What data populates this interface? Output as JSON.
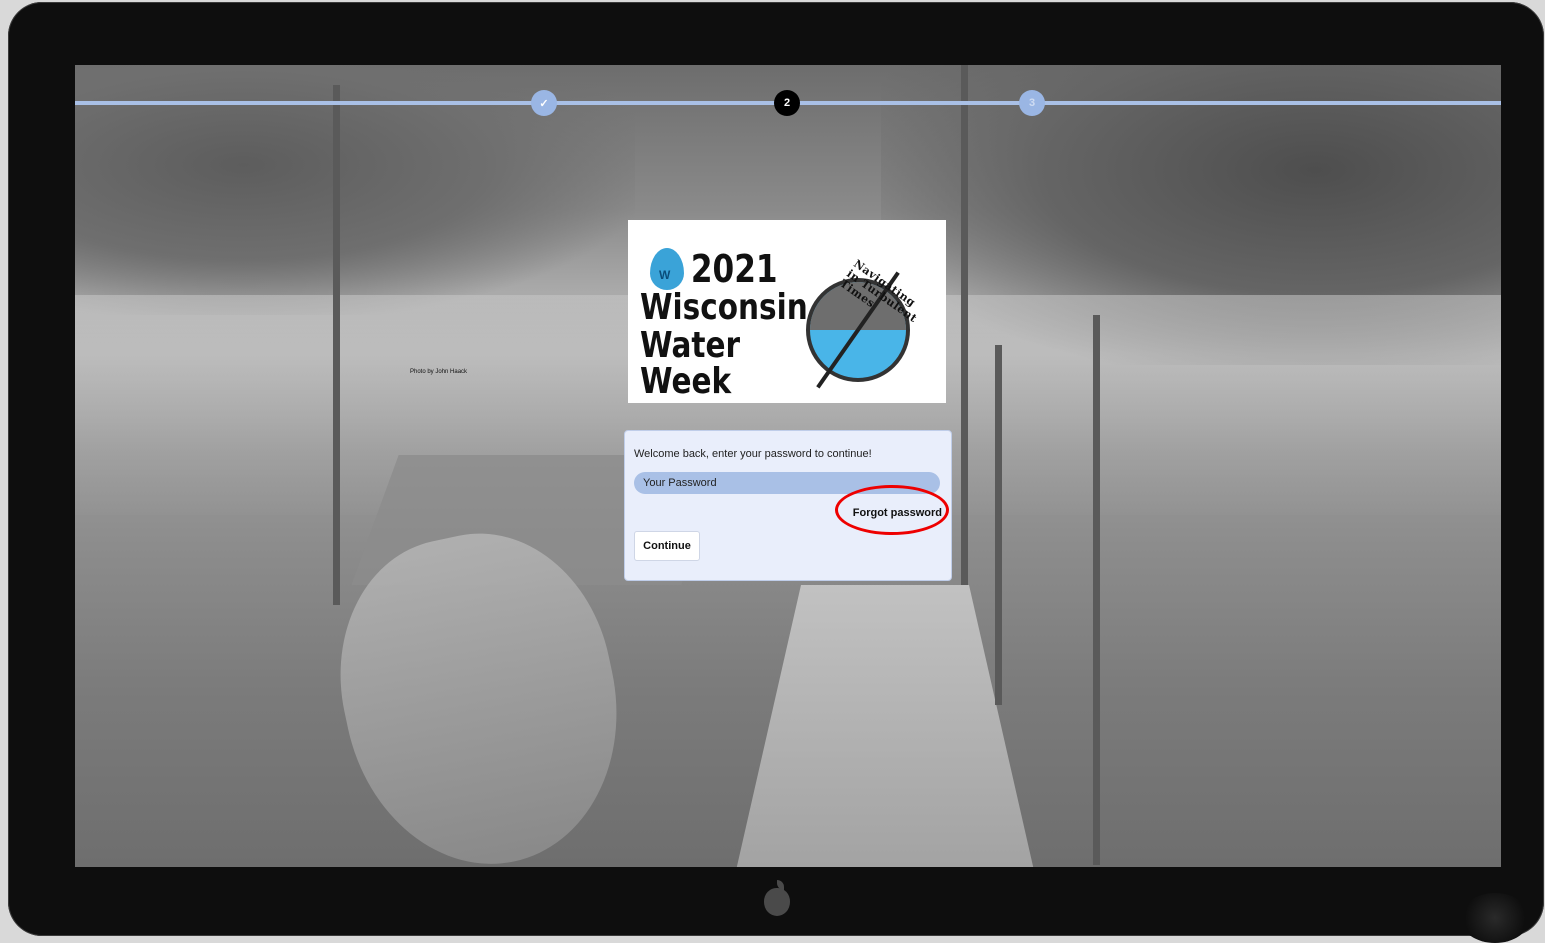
{
  "progress": {
    "steps": [
      {
        "label": "",
        "state": "done",
        "icon": "check-icon"
      },
      {
        "label": "2",
        "state": "current"
      },
      {
        "label": "3",
        "state": "pending"
      }
    ]
  },
  "logo": {
    "year": "2021",
    "line1": "Wisconsin",
    "line2": "Water Week",
    "slogan": "Navigating in Turbulent Times"
  },
  "background": {
    "photo_credit": "Photo by John Haack"
  },
  "login": {
    "welcome_text": "Welcome back, enter your password to continue!",
    "password_placeholder": "Your Password",
    "forgot_password_label": "Forgot password",
    "continue_label": "Continue"
  },
  "colors": {
    "accent": "#a9c0e6",
    "step_current": "#000000",
    "highlight": "#e00000",
    "bezel": "#0e0e0e"
  }
}
